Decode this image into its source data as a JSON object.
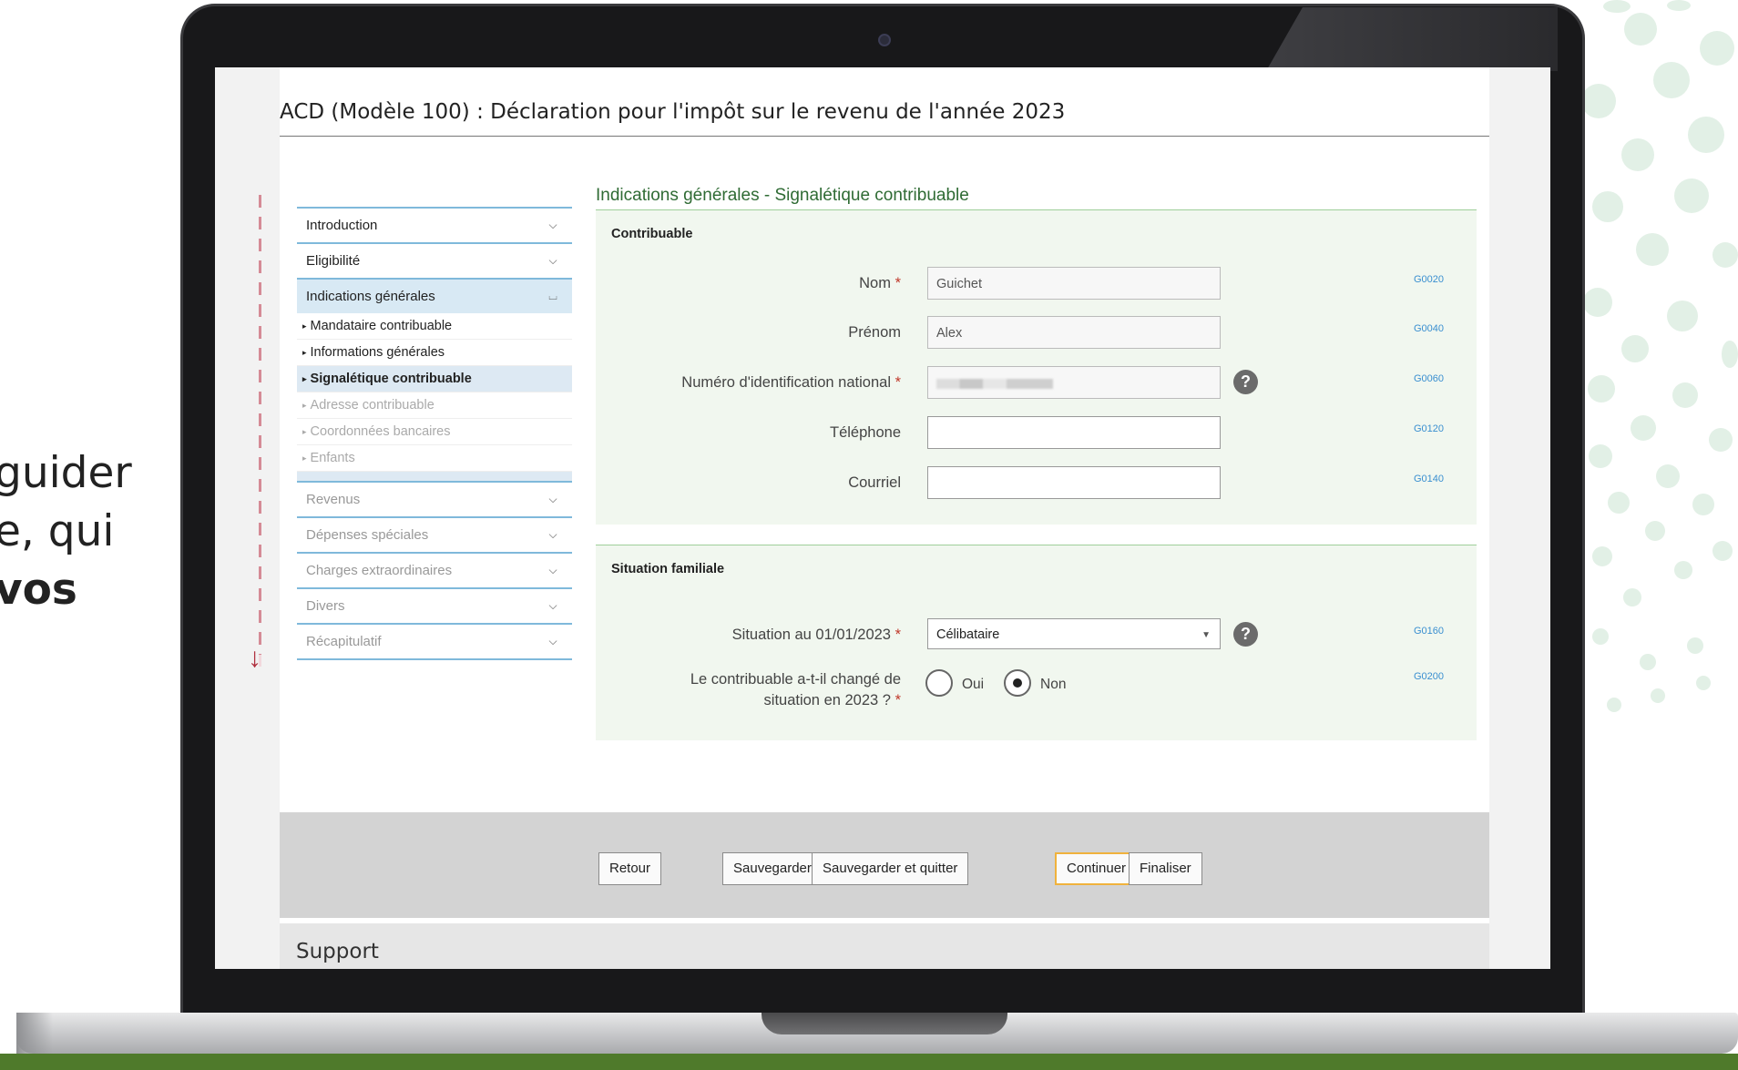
{
  "side_text": {
    "line1": "guider",
    "line2": "e, qui",
    "line3": "vos"
  },
  "page_title": "ACD (Modèle 100) : Déclaration pour l'impôt sur le revenu de l'année 2023",
  "nav": {
    "introduction": "Introduction",
    "eligibilite": "Eligibilité",
    "indications": "Indications générales",
    "sub_mandataire": "Mandataire contribuable",
    "sub_infos": "Informations générales",
    "sub_signaletique": "Signalétique contribuable",
    "sub_adresse": "Adresse contribuable",
    "sub_coordonnees": "Coordonnées bancaires",
    "sub_enfants": "Enfants",
    "revenus": "Revenus",
    "depenses": "Dépenses spéciales",
    "charges": "Charges extraordinaires",
    "divers": "Divers",
    "recap": "Récapitulatif"
  },
  "section_title": "Indications générales - Signalétique contribuable",
  "contribuable": {
    "heading": "Contribuable",
    "nom_label": "Nom",
    "nom_value": "Guichet",
    "nom_code": "G0020",
    "prenom_label": "Prénom",
    "prenom_value": "Alex",
    "prenom_code": "G0040",
    "nin_label": "Numéro d'identification national",
    "nin_code": "G0060",
    "tel_label": "Téléphone",
    "tel_value": "",
    "tel_code": "G0120",
    "courriel_label": "Courriel",
    "courriel_value": "",
    "courriel_code": "G0140",
    "required_mark": "*",
    "help": "?"
  },
  "famille": {
    "heading": "Situation familiale",
    "situation_label": "Situation au 01/01/2023",
    "situation_value": "Célibataire",
    "situation_code": "G0160",
    "change_label_1": "Le contribuable a-t-il changé de",
    "change_label_2": "situation en 2023 ?",
    "change_code": "G0200",
    "oui": "Oui",
    "non": "Non",
    "selected": "Non"
  },
  "buttons": {
    "retour": "Retour",
    "sauvegarder": "Sauvegarder",
    "sauvegarder_quitter": "Sauvegarder et quitter",
    "continuer": "Continuer",
    "finaliser": "Finaliser"
  },
  "support": "Support",
  "colors": {
    "accent_green": "#2f6b34",
    "nav_border": "#7fb9db",
    "primary_border": "#f0b23c",
    "brand_strip": "#4f7a2b"
  }
}
